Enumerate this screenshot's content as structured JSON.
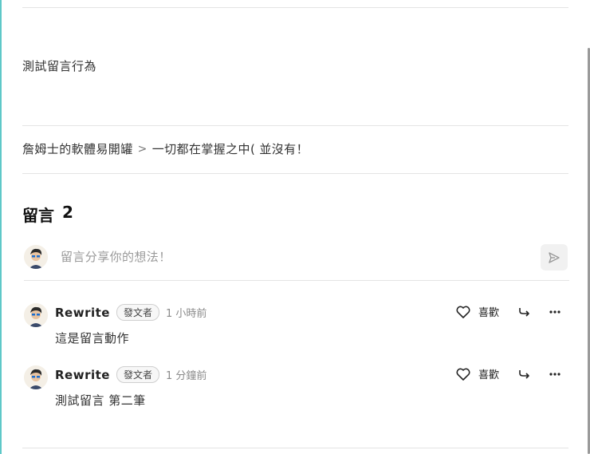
{
  "post": {
    "text": "測試留言行為"
  },
  "breadcrumb": {
    "parent": "詹姆士的軟體易開罐",
    "separator": ">",
    "current": "一切都在掌握之中( 並沒有！"
  },
  "comments_section": {
    "title": "留言",
    "count": "2",
    "input_placeholder": "留言分享你的想法！"
  },
  "comments": [
    {
      "author": "Rewrite",
      "badge": "發文者",
      "time": "1 小時前",
      "text": "這是留言動作",
      "like_label": "喜歡"
    },
    {
      "author": "Rewrite",
      "badge": "發文者",
      "time": "1 分鐘前",
      "text": "測試留言 第二筆",
      "like_label": "喜歡"
    }
  ],
  "colors": {
    "accent_left_border": "#5ec8c8",
    "divider": "#e4e4e4",
    "muted_text": "#8a8a8a"
  }
}
